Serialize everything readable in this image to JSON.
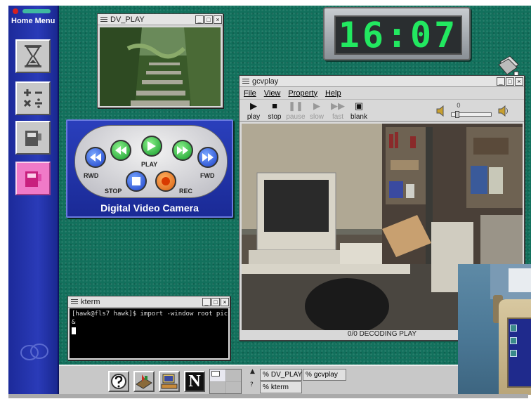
{
  "sidebar": {
    "title": "Home Menu",
    "buttons": [
      {
        "name": "hourglass-icon"
      },
      {
        "name": "calculator-icon"
      },
      {
        "name": "camcorder-icon"
      },
      {
        "name": "camcorder-active-icon",
        "active": true
      }
    ]
  },
  "dv_play_window": {
    "title": "DV_PLAY"
  },
  "clock": {
    "time": "16:07"
  },
  "dv_camera_panel": {
    "title": "Digital Video Camera",
    "labels": {
      "rwd": "RWD",
      "play": "PLAY",
      "fwd": "FWD",
      "stop": "STOP",
      "rec": "REC"
    }
  },
  "gcvplay_window": {
    "title": "gcvplay",
    "menu": [
      "File",
      "View",
      "Property",
      "Help"
    ],
    "toolbar": [
      {
        "label": "play",
        "enabled": true
      },
      {
        "label": "stop",
        "enabled": true
      },
      {
        "label": "pause",
        "enabled": false
      },
      {
        "label": "slow",
        "enabled": false
      },
      {
        "label": "fast",
        "enabled": false
      },
      {
        "label": "blank",
        "enabled": true
      }
    ],
    "volume_value": "0",
    "status": "0/0 DECODING PLAY"
  },
  "kterm_window": {
    "title": "kterm",
    "lines": [
      "[hawk@fls7 hawk]$ import -window root pic.jp",
      "&"
    ]
  },
  "taskbar": {
    "launchers": [
      "help-icon",
      "tool-icon",
      "display-icon",
      "netscape-icon"
    ],
    "netscape_letter": "N",
    "tasks": [
      "DV_PLAY",
      "gcvplay",
      "kterm"
    ],
    "task_prefix": "%",
    "pager_arrow": "▲",
    "pager_question": "?"
  },
  "colors": {
    "desktop": "#12705c",
    "sidebar": "#2a3bb8",
    "clock_digits": "#22e860"
  }
}
